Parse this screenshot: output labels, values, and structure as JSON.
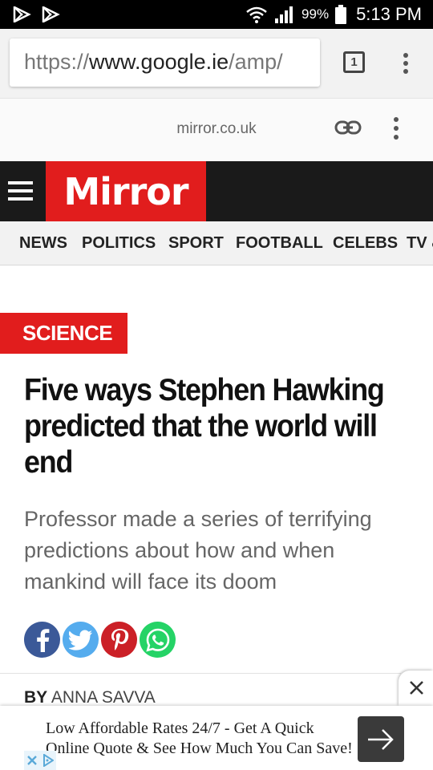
{
  "status_bar": {
    "battery": "99%",
    "time": "5:13 PM"
  },
  "browser": {
    "url_scheme": "https://",
    "url_domain": "www.google.ie",
    "url_rest": "/amp/",
    "tab_count": "1"
  },
  "amp_viewer": {
    "domain": "mirror.co.uk"
  },
  "site": {
    "logo": "Mirror",
    "nav": [
      "NEWS",
      "POLITICS",
      "SPORT",
      "FOOTBALL",
      "CELEBS",
      "TV &"
    ]
  },
  "article": {
    "section": "SCIENCE",
    "headline": "Five ways Stephen Hawking predicted that the world will end",
    "standfirst": "Professor made a series of terrifying predictions about how and when mankind will face its doom",
    "byline_prefix": "BY",
    "author": "ANNA SAVVA"
  },
  "share": {
    "colors": {
      "facebook": "#3b5998",
      "twitter": "#55acee",
      "pinterest": "#cb2027",
      "whatsapp": "#25d366"
    }
  },
  "ad": {
    "line1": "Low Affordable Rates 24/7 - Get A Quick",
    "line2": "Online Quote & See How Much You Can Save!"
  },
  "colors": {
    "brand_red": "#e11d1d",
    "header_dark": "#1a1a1a"
  }
}
